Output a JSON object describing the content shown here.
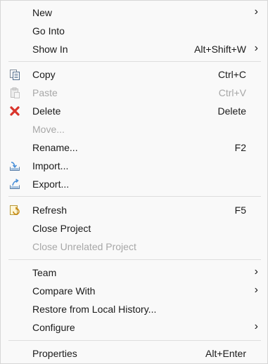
{
  "menu": {
    "items": [
      {
        "label": "New",
        "shortcut": "",
        "submenu": true,
        "disabled": false,
        "icon": ""
      },
      {
        "label": "Go Into",
        "shortcut": "",
        "submenu": false,
        "disabled": false,
        "icon": ""
      },
      {
        "label": "Show In",
        "shortcut": "Alt+Shift+W",
        "submenu": true,
        "disabled": false,
        "icon": ""
      },
      {
        "label": "Copy",
        "shortcut": "Ctrl+C",
        "submenu": false,
        "disabled": false,
        "icon": "copy-icon"
      },
      {
        "label": "Paste",
        "shortcut": "Ctrl+V",
        "submenu": false,
        "disabled": true,
        "icon": "paste-icon"
      },
      {
        "label": "Delete",
        "shortcut": "Delete",
        "submenu": false,
        "disabled": false,
        "icon": "delete-icon"
      },
      {
        "label": "Move...",
        "shortcut": "",
        "submenu": false,
        "disabled": true,
        "icon": ""
      },
      {
        "label": "Rename...",
        "shortcut": "F2",
        "submenu": false,
        "disabled": false,
        "icon": ""
      },
      {
        "label": "Import...",
        "shortcut": "",
        "submenu": false,
        "disabled": false,
        "icon": "import-icon"
      },
      {
        "label": "Export...",
        "shortcut": "",
        "submenu": false,
        "disabled": false,
        "icon": "export-icon"
      },
      {
        "label": "Refresh",
        "shortcut": "F5",
        "submenu": false,
        "disabled": false,
        "icon": "refresh-icon"
      },
      {
        "label": "Close Project",
        "shortcut": "",
        "submenu": false,
        "disabled": false,
        "icon": ""
      },
      {
        "label": "Close Unrelated Project",
        "shortcut": "",
        "submenu": false,
        "disabled": true,
        "icon": ""
      },
      {
        "label": "Team",
        "shortcut": "",
        "submenu": true,
        "disabled": false,
        "icon": ""
      },
      {
        "label": "Compare With",
        "shortcut": "",
        "submenu": true,
        "disabled": false,
        "icon": ""
      },
      {
        "label": "Restore from Local History...",
        "shortcut": "",
        "submenu": false,
        "disabled": false,
        "icon": ""
      },
      {
        "label": "Configure",
        "shortcut": "",
        "submenu": true,
        "disabled": false,
        "icon": ""
      },
      {
        "label": "Properties",
        "shortcut": "Alt+Enter",
        "submenu": false,
        "disabled": false,
        "icon": ""
      }
    ],
    "submenu_arrow": "›",
    "colors": {
      "background": "#f9f9f9",
      "text": "#1a1a1a",
      "disabled_text": "#a7a7a7",
      "separator": "#dedede",
      "delete_icon": "#d9342b"
    }
  }
}
